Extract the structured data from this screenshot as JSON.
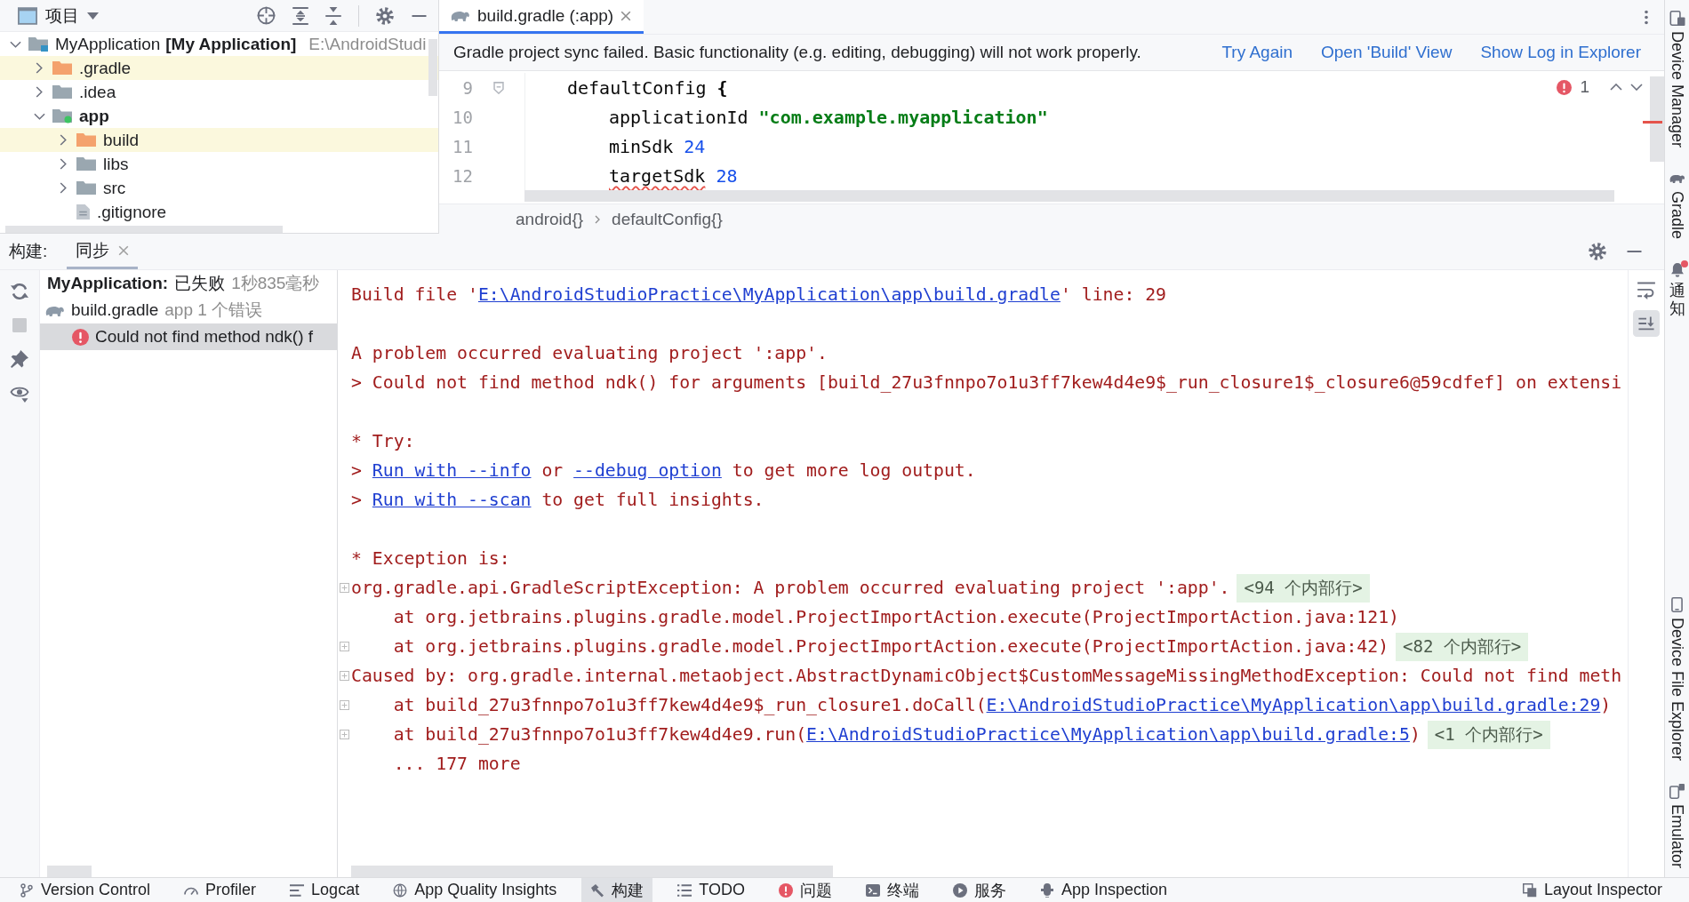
{
  "project_panel": {
    "title": "项目",
    "tree": [
      {
        "kind": "project",
        "name": "MyApplication",
        "label": "[My Application]",
        "path": "E:\\AndroidStudi",
        "expanded": true,
        "excluded": false,
        "children": [
          {
            "kind": "folder",
            "name": ".gradle",
            "expanded": false,
            "excluded": true
          },
          {
            "kind": "folder",
            "name": ".idea",
            "expanded": false,
            "excluded": false
          },
          {
            "kind": "module",
            "name": "app",
            "expanded": true,
            "excluded": false,
            "children": [
              {
                "kind": "folder",
                "name": "build",
                "expanded": false,
                "excluded": true
              },
              {
                "kind": "folder",
                "name": "libs",
                "expanded": false,
                "excluded": false
              },
              {
                "kind": "folder",
                "name": "src",
                "expanded": false,
                "excluded": false
              },
              {
                "kind": "file",
                "name": ".gitignore",
                "excluded": false
              }
            ]
          }
        ]
      }
    ]
  },
  "editor": {
    "tabs": [
      {
        "title": "build.gradle (:app)",
        "selected": true
      }
    ],
    "banner": {
      "message": "Gradle project sync failed. Basic functionality (e.g. editing, debugging) will not work properly.",
      "actions": [
        "Try Again",
        "Open 'Build' View",
        "Show Log in Explorer"
      ]
    },
    "code": {
      "lines": [
        {
          "number": "9",
          "foldable": true,
          "tokens": [
            {
              "text": "defaultConfig",
              "kind": "plain",
              "warning": false
            },
            {
              "text": "{",
              "kind": "brace",
              "warning": false
            }
          ],
          "children": [
            {
              "number": "10",
              "foldable": false,
              "tokens": [
                {
                  "text": "applicationId",
                  "kind": "plain",
                  "warning": false
                },
                {
                  "text": "\"com.example.myapplication\"",
                  "kind": "string",
                  "warning": false
                }
              ]
            },
            {
              "number": "11",
              "foldable": false,
              "tokens": [
                {
                  "text": "minSdk",
                  "kind": "plain",
                  "warning": false
                },
                {
                  "text": "24",
                  "kind": "number",
                  "warning": false
                }
              ]
            },
            {
              "number": "12",
              "foldable": false,
              "tokens": [
                {
                  "text": "targetSdk",
                  "kind": "plain",
                  "warning": true
                },
                {
                  "text": "28",
                  "kind": "number",
                  "warning": false
                }
              ]
            }
          ]
        }
      ]
    },
    "problems": {
      "errors": "1"
    },
    "breadcrumbs": [
      "android{}",
      "defaultConfig{}"
    ]
  },
  "build_panel": {
    "label": "构建:",
    "tabs": [
      {
        "title": "同步",
        "selected": true
      }
    ],
    "tree": [
      {
        "kind": "status",
        "name": "MyApplication:",
        "status": "已失败",
        "detail": "1秒835毫秒",
        "selected": false,
        "children": [
          {
            "kind": "file",
            "name": "build.gradle",
            "detail": "app 1 个错误",
            "selected": false,
            "children": [
              {
                "kind": "error",
                "name": "Could not find method ndk() f",
                "selected": true
              }
            ]
          }
        ]
      }
    ],
    "console": {
      "blocks": [
        {
          "lines": [
            {
              "fold": false,
              "segments": [
                {
                  "text": "Build file '",
                  "link": false
                },
                {
                  "text": "E:\\AndroidStudioPractice\\MyApplication\\app\\build.gradle",
                  "link": true
                },
                {
                  "text": "' line: 29",
                  "link": false
                }
              ]
            }
          ]
        },
        {
          "lines": [
            {
              "fold": false,
              "segments": [
                {
                  "text": "A problem occurred evaluating project ':app'.",
                  "link": false
                }
              ]
            },
            {
              "fold": false,
              "segments": [
                {
                  "text": "> Could not find method ndk() for arguments [build_27u3fnnpo7o1u3ff7kew4d4e9$_run_closure1$_closure6@59cdfef] on extensi",
                  "link": false
                }
              ]
            }
          ]
        },
        {
          "lines": [
            {
              "fold": false,
              "segments": [
                {
                  "text": "* Try:",
                  "link": false
                }
              ]
            },
            {
              "fold": false,
              "segments": [
                {
                  "text": "> ",
                  "link": false
                },
                {
                  "text": "Run with --info",
                  "link": true
                },
                {
                  "text": " or ",
                  "link": false
                },
                {
                  "text": "--debug option",
                  "link": true
                },
                {
                  "text": " to get more log output.",
                  "link": false
                }
              ]
            },
            {
              "fold": false,
              "segments": [
                {
                  "text": "> ",
                  "link": false
                },
                {
                  "text": "Run with --scan",
                  "link": true
                },
                {
                  "text": " to get full insights.",
                  "link": false
                }
              ]
            }
          ]
        },
        {
          "lines": [
            {
              "fold": false,
              "segments": [
                {
                  "text": "* Exception is:",
                  "link": false
                }
              ]
            },
            {
              "fold": true,
              "segments": [
                {
                  "text": "org.gradle.api.GradleScriptException: A problem occurred evaluating project ':app'.",
                  "link": false
                }
              ],
              "badge": "<94 个内部行>",
              "children": [
                {
                  "fold": false,
                  "segments": [
                    {
                      "text": "at org.jetbrains.plugins.gradle.model.ProjectImportAction.execute(ProjectImportAction.java:121)",
                      "link": false
                    }
                  ]
                },
                {
                  "fold": true,
                  "segments": [
                    {
                      "text": "at org.jetbrains.plugins.gradle.model.ProjectImportAction.execute(ProjectImportAction.java:42)",
                      "link": false
                    }
                  ],
                  "badge": "<82 个内部行>"
                }
              ]
            },
            {
              "fold": true,
              "segments": [
                {
                  "text": "Caused by: org.gradle.internal.metaobject.AbstractDynamicObject$CustomMessageMissingMethodException: Could not find meth",
                  "link": false
                }
              ],
              "children": [
                {
                  "fold": true,
                  "segments": [
                    {
                      "text": "at build_27u3fnnpo7o1u3ff7kew4d4e9$_run_closure1.doCall(",
                      "link": false
                    },
                    {
                      "text": "E:\\AndroidStudioPractice\\MyApplication\\app\\build.gradle:29",
                      "link": true
                    },
                    {
                      "text": ")",
                      "link": false
                    }
                  ]
                },
                {
                  "fold": true,
                  "segments": [
                    {
                      "text": "at build_27u3fnnpo7o1u3ff7kew4d4e9.run(",
                      "link": false
                    },
                    {
                      "text": "E:\\AndroidStudioPractice\\MyApplication\\app\\build.gradle:5",
                      "link": true
                    },
                    {
                      "text": ")",
                      "link": false
                    }
                  ],
                  "badge": "<1 个内部行>"
                },
                {
                  "fold": false,
                  "segments": [
                    {
                      "text": "... 177 more",
                      "link": false
                    }
                  ]
                }
              ]
            }
          ]
        }
      ]
    }
  },
  "right_toolbar": {
    "top": [
      {
        "label": "Device Manager",
        "alert": false
      },
      {
        "label": "Gradle",
        "alert": false
      },
      {
        "label": "通知",
        "alert": true
      }
    ],
    "bottom": [
      {
        "label": "Device File Explorer",
        "alert": false
      },
      {
        "label": "Emulator",
        "alert": false
      }
    ]
  },
  "bottom_bar": {
    "left": [
      {
        "label": "Version Control",
        "selected": false
      },
      {
        "label": "Profiler",
        "selected": false
      },
      {
        "label": "Logcat",
        "selected": false
      },
      {
        "label": "App Quality Insights",
        "selected": false
      },
      {
        "label": "构建",
        "selected": true
      },
      {
        "label": "TODO",
        "selected": false
      },
      {
        "label": "问题",
        "selected": false
      },
      {
        "label": "终端",
        "selected": false
      },
      {
        "label": "服务",
        "selected": false
      },
      {
        "label": "App Inspection",
        "selected": false
      }
    ],
    "right": [
      {
        "label": "Layout Inspector",
        "selected": false
      }
    ]
  }
}
